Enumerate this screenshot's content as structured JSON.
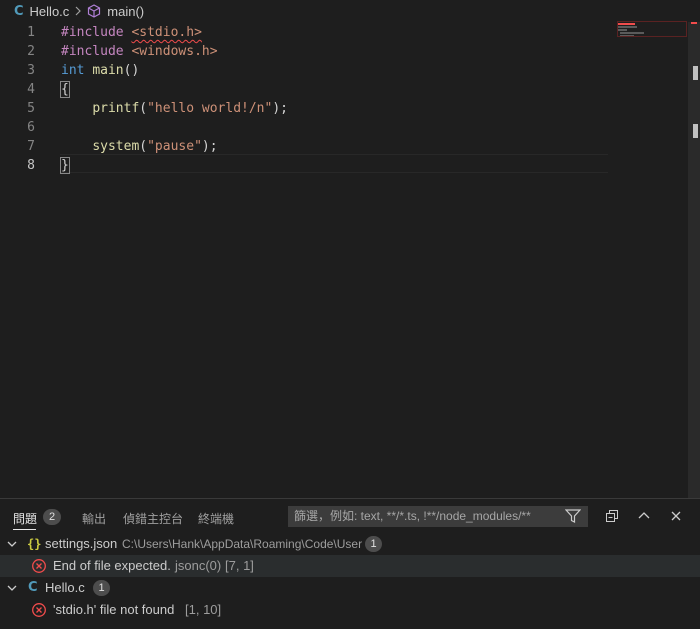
{
  "breadcrumb": {
    "file": "Hello.c",
    "file_icon": "C",
    "symbol": "main()"
  },
  "editor": {
    "lines": [
      {
        "n": "1",
        "tokens": [
          {
            "t": "#include ",
            "c": "kw"
          },
          {
            "t": "<stdio.h>",
            "c": "str",
            "squiggle": true
          }
        ]
      },
      {
        "n": "2",
        "tokens": [
          {
            "t": "#include ",
            "c": "kw"
          },
          {
            "t": "<windows.h>",
            "c": "str"
          }
        ]
      },
      {
        "n": "3",
        "tokens": [
          {
            "t": "int",
            "c": "type"
          },
          {
            "t": " ",
            "c": "txt"
          },
          {
            "t": "main",
            "c": "fn"
          },
          {
            "t": "()",
            "c": "txt"
          }
        ]
      },
      {
        "n": "4",
        "tokens": [
          {
            "t": "{",
            "c": "txt",
            "box": true
          }
        ]
      },
      {
        "n": "5",
        "tokens": [
          {
            "t": "    ",
            "c": "txt"
          },
          {
            "t": "printf",
            "c": "fn"
          },
          {
            "t": "(",
            "c": "txt"
          },
          {
            "t": "\"hello world!/n\"",
            "c": "str"
          },
          {
            "t": ");",
            "c": "txt"
          }
        ]
      },
      {
        "n": "6",
        "tokens": []
      },
      {
        "n": "7",
        "tokens": [
          {
            "t": "    ",
            "c": "txt"
          },
          {
            "t": "system",
            "c": "fn"
          },
          {
            "t": "(",
            "c": "txt"
          },
          {
            "t": "\"pause\"",
            "c": "str"
          },
          {
            "t": ");",
            "c": "txt"
          }
        ]
      },
      {
        "n": "8",
        "tokens": [
          {
            "t": "}",
            "c": "txt",
            "box": true
          }
        ]
      }
    ],
    "active_line": "8"
  },
  "panel": {
    "tabs": [
      {
        "label": "問題",
        "active": true,
        "badge": "2"
      },
      {
        "label": "輸出"
      },
      {
        "label": "偵錯主控台"
      },
      {
        "label": "終端機"
      }
    ],
    "filter_placeholder": "篩選，例如: text, **/*.ts, !**/node_modules/**",
    "groups": [
      {
        "file_icon": "{}",
        "file": "settings.json",
        "path": "C:\\Users\\Hank\\AppData\\Roaming\\Code\\User",
        "count": "1",
        "problems": [
          {
            "message": "End of file expected.",
            "source": "jsonc(0)",
            "position": "[7, 1]"
          }
        ]
      },
      {
        "file_icon": "C",
        "file": "Hello.c",
        "path": "",
        "count": "1",
        "problems": [
          {
            "message": "'stdio.h' file not found",
            "source": "",
            "position": "[1, 10]"
          }
        ]
      }
    ]
  },
  "colors": {
    "error": "#f14c4c",
    "accent": "#519aba",
    "background": "#1e1e1e"
  }
}
